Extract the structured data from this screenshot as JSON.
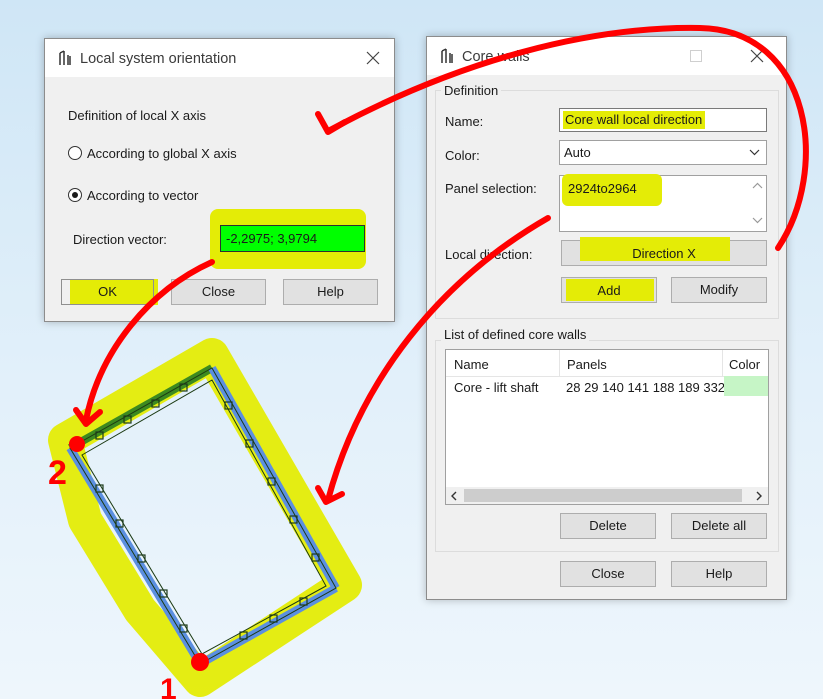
{
  "dialog_local": {
    "title": "Local system orientation",
    "section_label": "Definition of local X axis",
    "radio_global": "According to global X axis",
    "radio_vector": "According to vector",
    "direction_label": "Direction vector:",
    "direction_value": "-2,2975; 3,9794",
    "ok": "OK",
    "close": "Close",
    "help": "Help"
  },
  "dialog_core": {
    "title": "Core walls",
    "definition_label": "Definition",
    "name_label": "Name:",
    "name_value": "Core wall local direction",
    "color_label": "Color:",
    "color_value": "Auto",
    "panel_label": "Panel selection:",
    "panel_value": "2924to2964",
    "local_dir_label": "Local direction:",
    "direction_button": "Direction X",
    "add": "Add",
    "modify": "Modify",
    "list_label": "List of defined core walls",
    "columns": [
      "Name",
      "Panels",
      "Color"
    ],
    "rows": [
      {
        "name": "Core - lift shaft",
        "panels": "28 29 140 141 188 189 332"
      }
    ],
    "delete": "Delete",
    "delete_all": "Delete all",
    "close": "Close",
    "help": "Help"
  },
  "annotations": {
    "label_1": "1",
    "label_2": "2"
  },
  "colors": {
    "highlight_yellow": "#e4ec06",
    "vector_field_green": "#00ff00",
    "row_color_swatch": "#c6f5c6",
    "annotation_red": "#ff0000",
    "wall_blue": "#5b8fe0",
    "wall_green": "#3d8a1f"
  }
}
